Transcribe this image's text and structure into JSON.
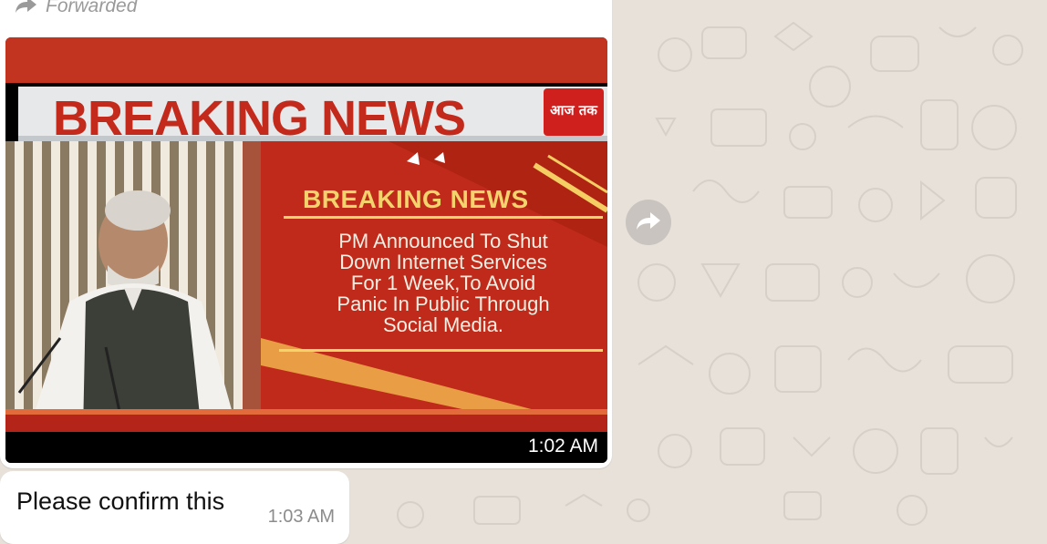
{
  "forwarded_label": "Forwarded",
  "media": {
    "headline_top": "BREAKING NEWS",
    "headline_box": "BREAKING NEWS",
    "channel_logo_text": "आज तक",
    "story_lines": [
      "PM Announced To Shut",
      "Down Internet Services",
      "For 1 Week,To Avoid",
      "Panic In Public Through",
      "Social Media."
    ],
    "timestamp": "1:02 AM"
  },
  "second_message": {
    "text": "Please confirm this",
    "time": "1:03 AM"
  },
  "icons": {
    "forwarded": "forward-arrow-icon",
    "share": "share-forward-icon"
  },
  "colors": {
    "chat_bg": "#e7e1da",
    "bubble": "#ffffff",
    "news_red": "#c0281b",
    "news_yellow": "#f2d36c"
  }
}
